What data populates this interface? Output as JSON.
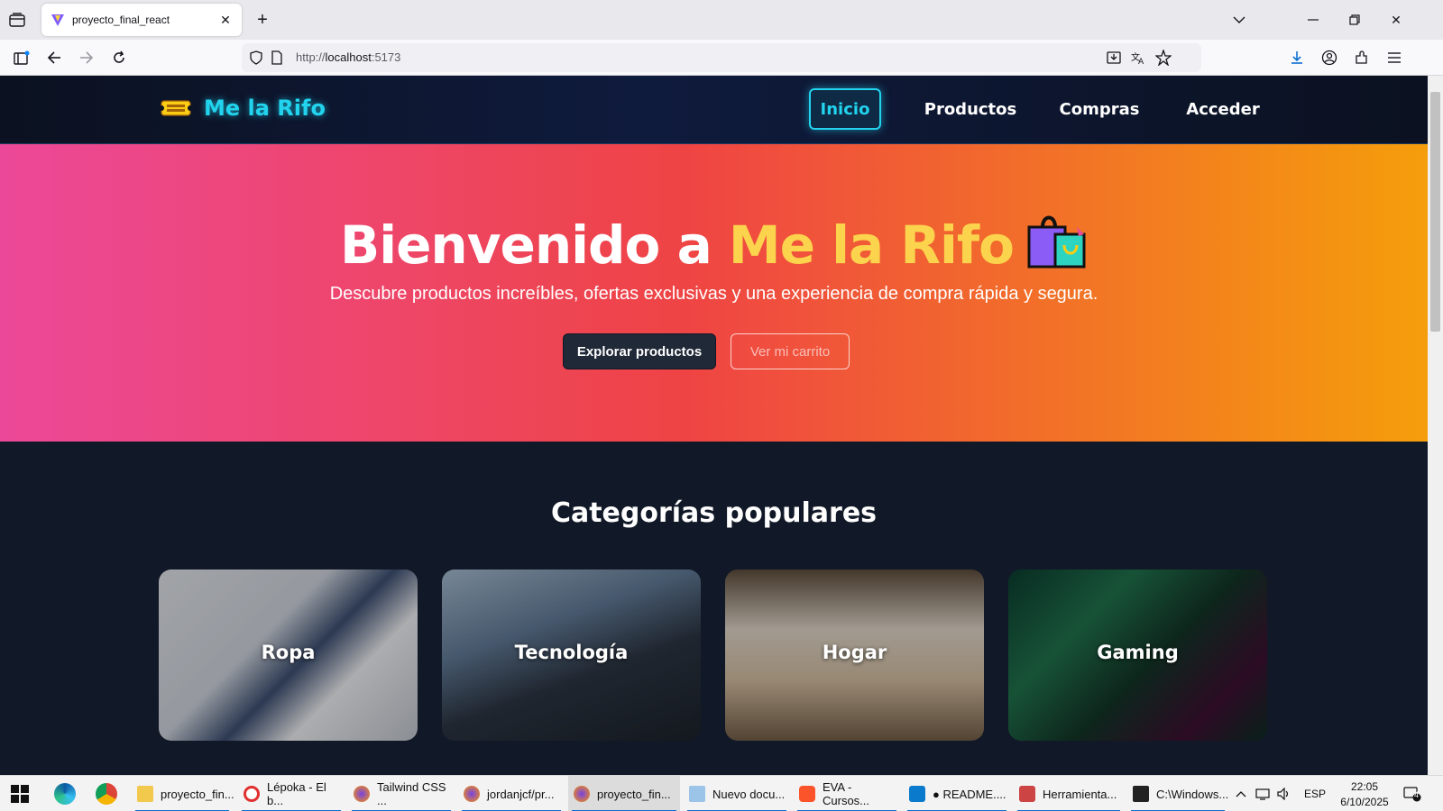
{
  "browser": {
    "tab_title": "proyecto_final_react",
    "url_prefix": "http://",
    "url_host": "localhost",
    "url_port": ":5173"
  },
  "site": {
    "brand": "Me la Rifo",
    "nav": {
      "inicio": "Inicio",
      "productos": "Productos",
      "compras": "Compras",
      "acceder": "Acceder"
    },
    "hero": {
      "title_prefix": "Bienvenido a ",
      "title_accent": "Me la Rifo",
      "subtitle": "Descubre productos increíbles, ofertas exclusivas y una experiencia de compra rápida y segura.",
      "btn_explore": "Explorar productos",
      "btn_cart": "Ver mi carrito"
    },
    "categories_title": "Categorías populares",
    "categories": [
      {
        "label": "Ropa"
      },
      {
        "label": "Tecnología"
      },
      {
        "label": "Hogar"
      },
      {
        "label": "Gaming"
      }
    ]
  },
  "taskbar": {
    "items": [
      {
        "label": "proyecto_fin..."
      },
      {
        "label": "Lépoka - El b..."
      },
      {
        "label": "Tailwind CSS ..."
      },
      {
        "label": "jordanjcf/pr..."
      },
      {
        "label": "proyecto_fin..."
      },
      {
        "label": "Nuevo docu..."
      },
      {
        "label": "EVA - Cursos..."
      },
      {
        "label": "● README...."
      },
      {
        "label": "Herramienta..."
      },
      {
        "label": "C:\\Windows..."
      }
    ],
    "lang": "ESP",
    "time": "22:05",
    "date": "6/10/2025",
    "notif_count": "4"
  }
}
